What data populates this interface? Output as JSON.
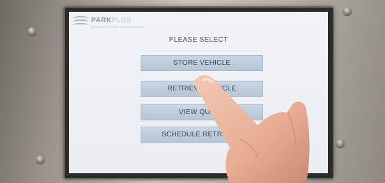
{
  "app": {
    "brand": "PARK",
    "brand_suffix": "PLUS",
    "tagline": "AUTOMATED PARKING SOLUTIONS"
  },
  "screen": {
    "prompt": "PLEASE SELECT",
    "buttons": [
      {
        "label": "STORE VEHICLE"
      },
      {
        "label": "RETRIEVE VEHICLE"
      },
      {
        "label": "VIEW QUEUE"
      },
      {
        "label": "SCHEDULE RETRIEVAL"
      }
    ]
  },
  "colors": {
    "button_fill": "#bfcedd",
    "screen_bg": "#eef1f4",
    "text": "#3d444c"
  },
  "icons": {
    "logo": "parkplus-logo-icon",
    "screws": "screw-icon"
  }
}
